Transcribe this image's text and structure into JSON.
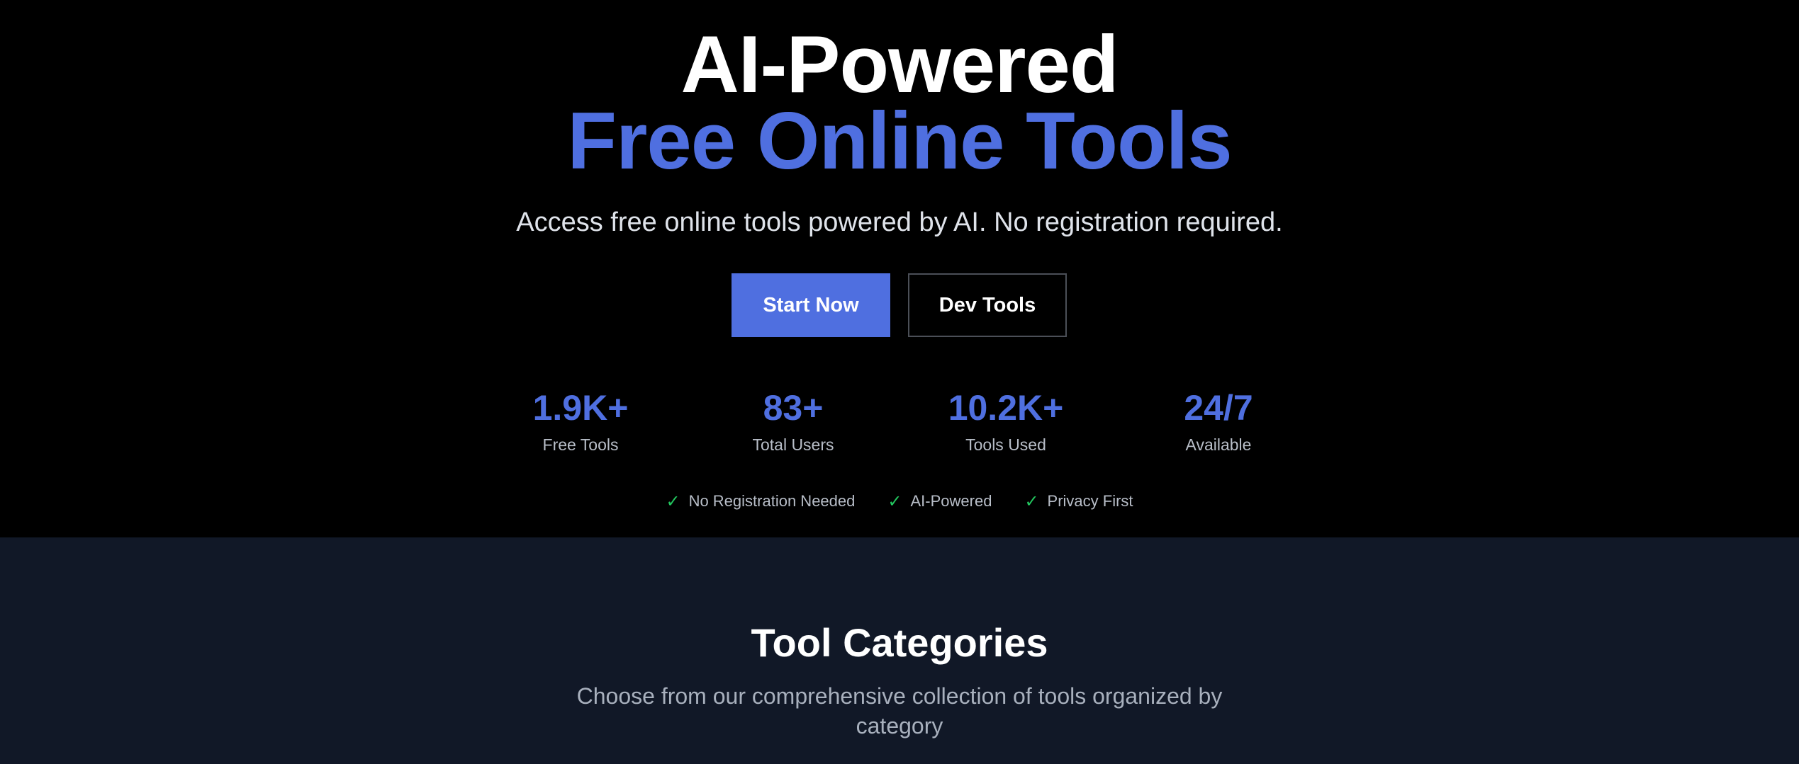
{
  "hero": {
    "title_line1": "AI-Powered",
    "title_line2": "Free Online Tools",
    "subtitle": "Access free online tools powered by AI. No registration required.",
    "primary_button": "Start Now",
    "secondary_button": "Dev Tools",
    "stats": [
      {
        "value": "1.9K+",
        "label": "Free Tools"
      },
      {
        "value": "83+",
        "label": "Total Users"
      },
      {
        "value": "10.2K+",
        "label": "Tools Used"
      },
      {
        "value": "24/7",
        "label": "Available"
      }
    ],
    "features": [
      {
        "icon": "checkmark-icon",
        "check": "✓",
        "label": "No Registration Needed"
      },
      {
        "icon": "checkmark-icon",
        "check": "✓",
        "label": "AI-Powered"
      },
      {
        "icon": "checkmark-icon",
        "check": "✓",
        "label": "Privacy First"
      }
    ]
  },
  "categories": {
    "title": "Tool Categories",
    "subtitle": "Choose from our comprehensive collection of tools organized by category"
  },
  "colors": {
    "accent": "#4f6fe0",
    "hero_background": "#000000",
    "section_background": "#111827",
    "check": "#22c55e"
  }
}
